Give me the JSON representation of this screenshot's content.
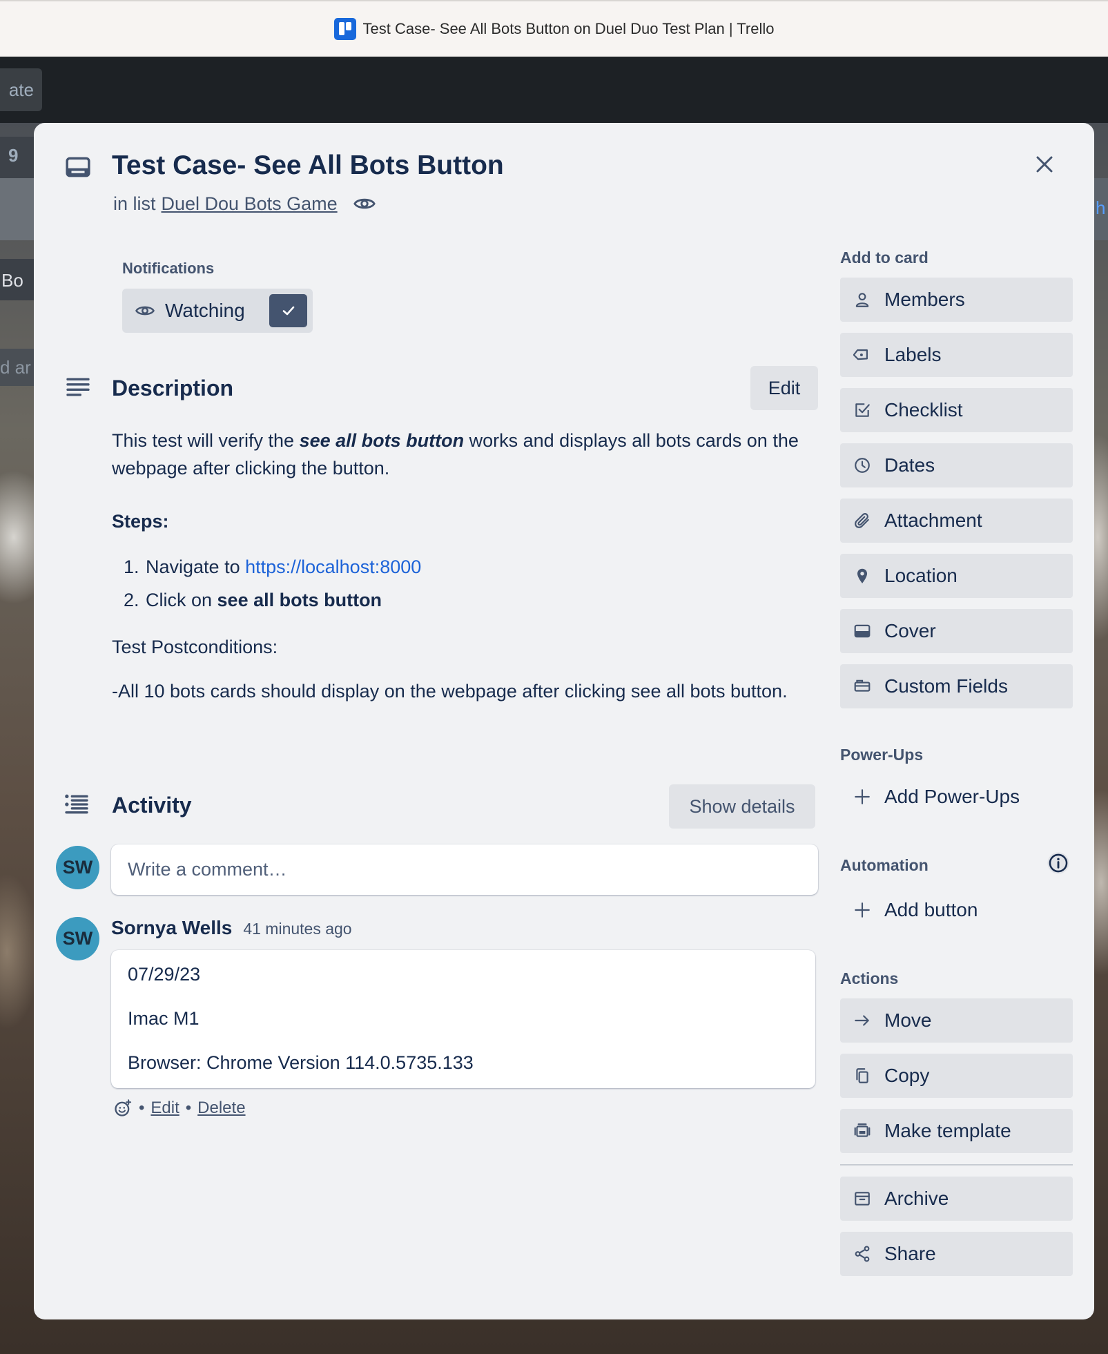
{
  "window": {
    "title": "Test Case- See All Bots Button on Duel Duo Test Plan | Trello"
  },
  "backdrop": {
    "header_button_label": "ate",
    "list_count": "9",
    "list_name_fragment": "Bo",
    "card_text_fragment": "d ar",
    "right_edge_fragment": "h"
  },
  "card": {
    "title": "Test Case- See All Bots Button",
    "in_list_prefix": "in list",
    "list_name": "Duel Dou Bots Game"
  },
  "notifications": {
    "heading": "Notifications",
    "watch_label": "Watching"
  },
  "description": {
    "heading": "Description",
    "edit_label": "Edit",
    "intro_before": "This test will verify the ",
    "intro_emphasis": "see all bots button",
    "intro_after": " works and displays all bots cards on the webpage after clicking the button.",
    "steps_label": "Steps:",
    "step1_text": "Navigate to ",
    "step1_link": "https://localhost:8000",
    "step2_text": "Click on ",
    "step2_bold": "see all bots button",
    "postconditions_label": "Test Postconditions:",
    "postconditions_text": "-All 10 bots cards should display on the webpage after clicking see all bots button."
  },
  "activity": {
    "heading": "Activity",
    "show_details_label": "Show details",
    "comment_placeholder": "Write a comment…",
    "avatar_initials": "SW",
    "comment": {
      "author": "Sornya Wells",
      "time": "41 minutes ago",
      "lines": [
        "07/29/23",
        "Imac M1",
        "Browser: Chrome Version 114.0.5735.133"
      ],
      "separator": "•",
      "edit_label": "Edit",
      "delete_label": "Delete"
    }
  },
  "sidebar": {
    "add_to_card_heading": "Add to card",
    "add_to_card": [
      {
        "label": "Members",
        "icon": "person-icon"
      },
      {
        "label": "Labels",
        "icon": "tag-icon"
      },
      {
        "label": "Checklist",
        "icon": "checklist-icon"
      },
      {
        "label": "Dates",
        "icon": "clock-icon"
      },
      {
        "label": "Attachment",
        "icon": "paperclip-icon"
      },
      {
        "label": "Location",
        "icon": "location-pin-icon"
      },
      {
        "label": "Cover",
        "icon": "cover-icon"
      },
      {
        "label": "Custom Fields",
        "icon": "custom-fields-icon"
      }
    ],
    "power_ups_heading": "Power-Ups",
    "add_power_ups_label": "Add Power-Ups",
    "automation_heading": "Automation",
    "add_button_label": "Add button",
    "actions_heading": "Actions",
    "actions": [
      {
        "label": "Move",
        "icon": "arrow-right-icon"
      },
      {
        "label": "Copy",
        "icon": "copy-icon"
      },
      {
        "label": "Make template",
        "icon": "template-icon"
      },
      {
        "label": "Archive",
        "icon": "archive-icon"
      },
      {
        "label": "Share",
        "icon": "share-icon"
      }
    ]
  },
  "colors": {
    "modal_bg": "#f1f2f4",
    "button_bg": "#e1e3e7",
    "text": "#172b4d",
    "subtle_text": "#44546f",
    "link": "#1d63d8",
    "avatar": "#3c9bbf",
    "trello_blue": "#1868db"
  }
}
